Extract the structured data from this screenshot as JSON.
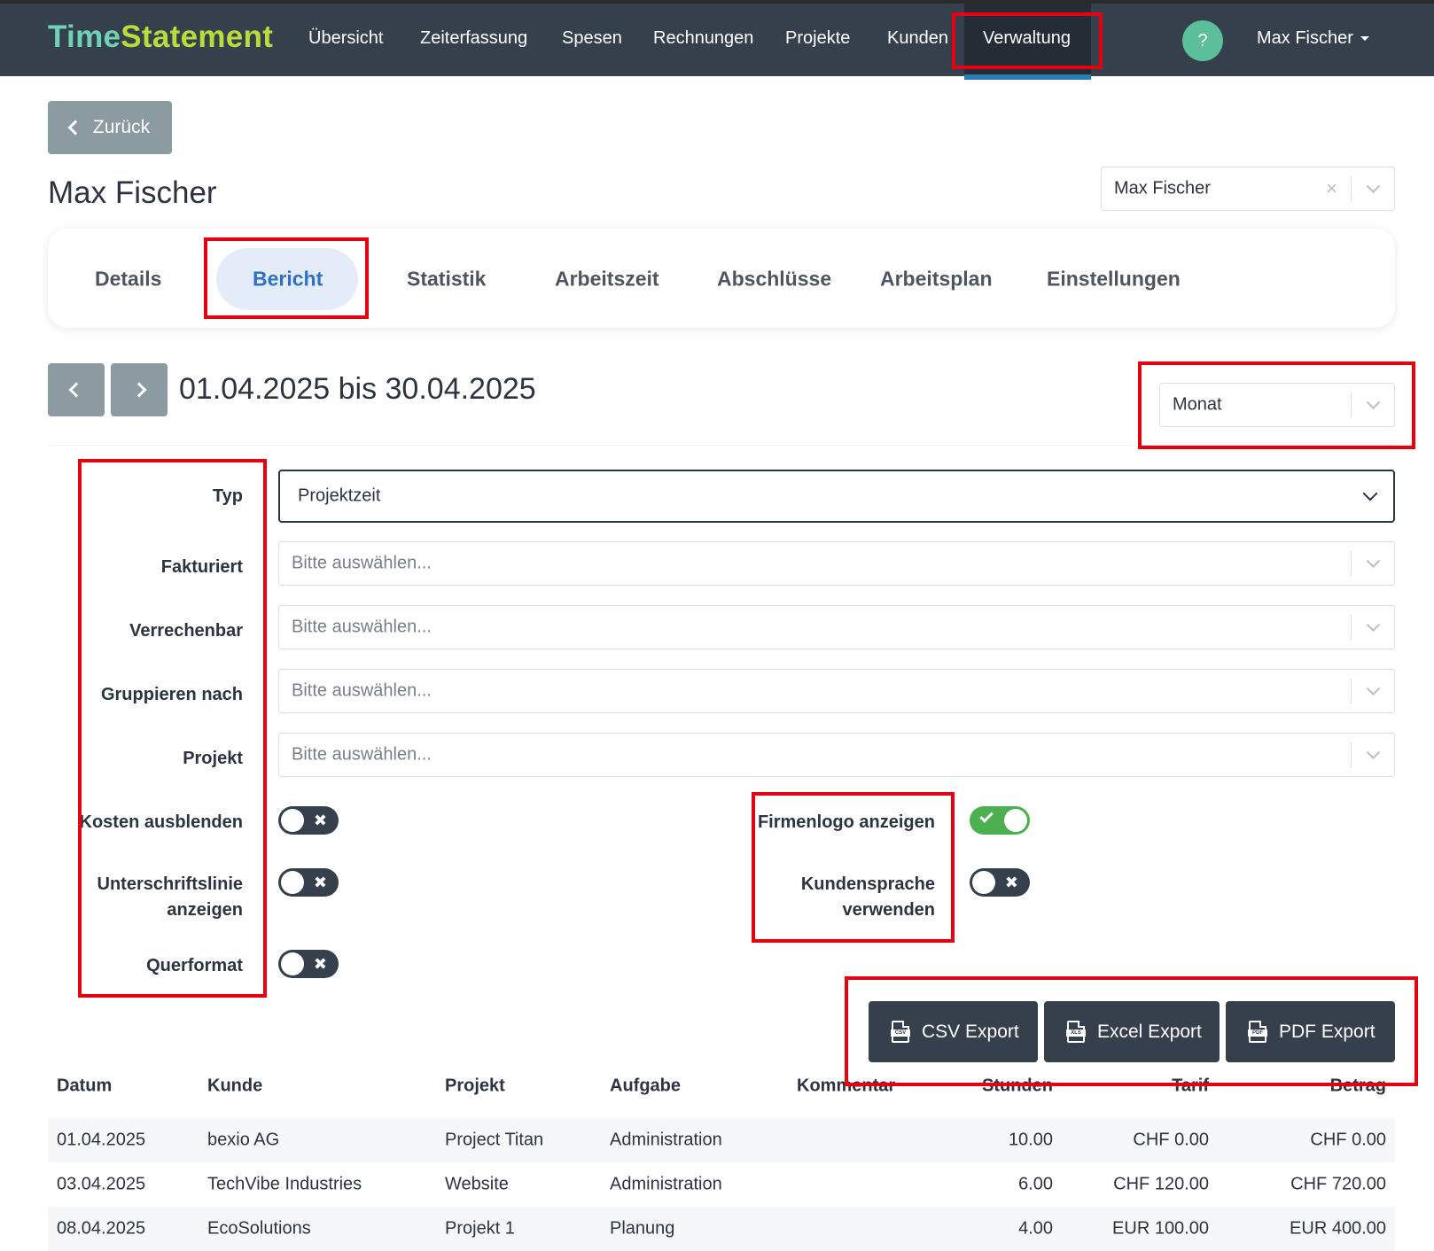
{
  "app": {
    "logo_part1": "Time",
    "logo_part2": "Statement"
  },
  "nav": {
    "items": [
      "Übersicht",
      "Zeiterfassung",
      "Spesen",
      "Rechnungen",
      "Projekte",
      "Kunden",
      "Verwaltung"
    ],
    "active": "Verwaltung",
    "help": "?",
    "user": "Max Fischer"
  },
  "back_label": "Zurück",
  "page_title": "Max Fischer",
  "employee_select": {
    "value": "Max Fischer",
    "clear": "×"
  },
  "tabs": [
    "Details",
    "Bericht",
    "Statistik",
    "Arbeitszeit",
    "Abschlüsse",
    "Arbeitsplan",
    "Einstellungen"
  ],
  "active_tab": "Bericht",
  "period": {
    "range": "01.04.2025 bis 30.04.2025",
    "granularity": "Monat"
  },
  "filters": {
    "typ_label": "Typ",
    "typ_value": "Projektzeit",
    "fakturiert_label": "Fakturiert",
    "verrechenbar_label": "Verrechenbar",
    "gruppieren_label": "Gruppieren nach",
    "projekt_label": "Projekt",
    "placeholder": "Bitte auswählen..."
  },
  "toggles": {
    "kosten_label": "Kosten ausblenden",
    "kosten_on": false,
    "unterschrift_label_1": "Unterschriftslinie",
    "unterschrift_label_2": "anzeigen",
    "unterschrift_on": false,
    "querformat_label": "Querformat",
    "querformat_on": false,
    "firmenlogo_label": "Firmenlogo anzeigen",
    "firmenlogo_on": true,
    "kundensprache_label_1": "Kundensprache",
    "kundensprache_label_2": "verwenden",
    "kundensprache_on": false
  },
  "exports": {
    "csv": "CSV Export",
    "excel": "Excel Export",
    "pdf": "PDF Export",
    "csv_icon_text": "CSV",
    "excel_icon_text": "XLS",
    "pdf_icon_text": "PDF"
  },
  "table": {
    "headers": [
      "Datum",
      "Kunde",
      "Projekt",
      "Aufgabe",
      "Kommentar",
      "Stunden",
      "Tarif",
      "Betrag"
    ],
    "rows": [
      [
        "01.04.2025",
        "bexio AG",
        "Project Titan",
        "Administration",
        "",
        "10.00",
        "CHF 0.00",
        "CHF 0.00"
      ],
      [
        "03.04.2025",
        "TechVibe Industries",
        "Website",
        "Administration",
        "",
        "6.00",
        "CHF 120.00",
        "CHF 720.00"
      ],
      [
        "08.04.2025",
        "EcoSolutions",
        "Projekt 1",
        "Planung",
        "",
        "4.00",
        "EUR 100.00",
        "EUR 400.00"
      ]
    ]
  },
  "colors": {
    "navbar": "#36404c",
    "annotation": "#e6000f",
    "accent": "#2f72c5",
    "toggle_on": "#4caf50"
  }
}
